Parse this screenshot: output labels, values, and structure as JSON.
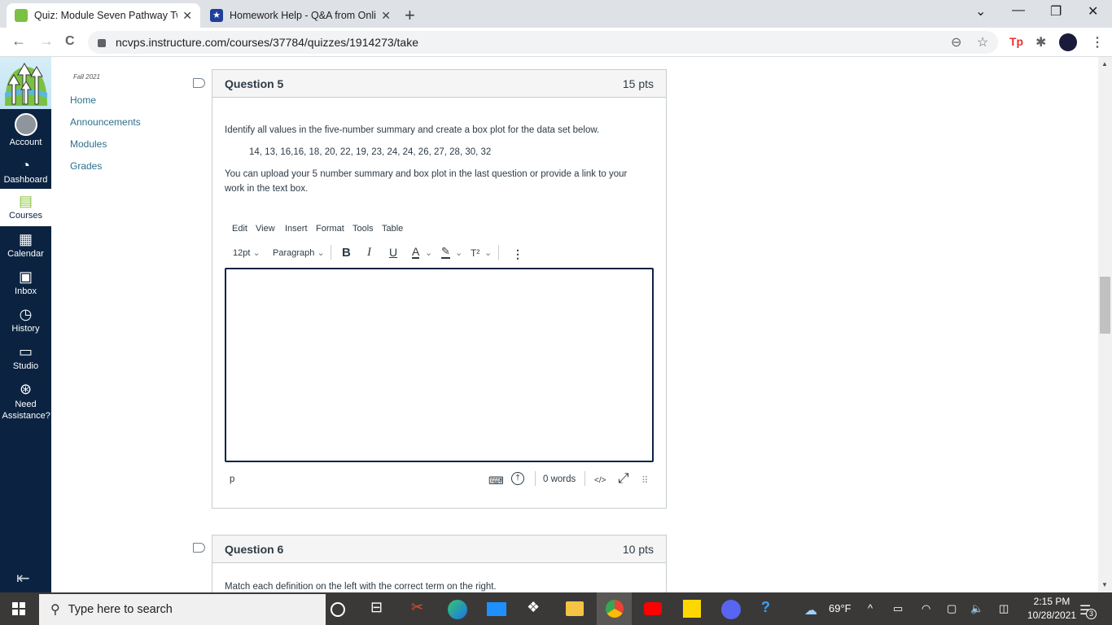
{
  "browser": {
    "tabs": [
      {
        "title": "Quiz: Module Seven Pathway Two",
        "active": true,
        "close": "✕"
      },
      {
        "title": "Homework Help - Q&A from Online",
        "active": false,
        "close": "✕"
      }
    ],
    "new_tab": "+",
    "window_controls": {
      "tab_search": "⌄",
      "minimize": "—",
      "restore": "❐",
      "close": "✕"
    },
    "nav": {
      "back": "←",
      "forward": "→",
      "reload": "C"
    },
    "url": "ncvps.instructure.com/courses/37784/quizzes/1914273/take",
    "toolbar_icons": {
      "zoom": "⊖",
      "bookmark": "☆",
      "extension_tp": "Tp",
      "extensions": "✱",
      "menu": "⋮"
    }
  },
  "global_nav": {
    "items": [
      {
        "label": "Account",
        "icon": "👤"
      },
      {
        "label": "Dashboard",
        "icon": "◔"
      },
      {
        "label": "Courses",
        "icon": "▤"
      },
      {
        "label": "Calendar",
        "icon": "▦"
      },
      {
        "label": "Inbox",
        "icon": "▣"
      },
      {
        "label": "History",
        "icon": "◷"
      },
      {
        "label": "Studio",
        "icon": "▭"
      },
      {
        "label": "Need Assistance?",
        "icon": "⊛"
      }
    ],
    "collapse": "⇤"
  },
  "course_nav": {
    "term": "Fall 2021",
    "items": [
      "Home",
      "Announcements",
      "Modules",
      "Grades"
    ]
  },
  "questions": [
    {
      "title": "Question 5",
      "points": "15 pts",
      "prompt": "Identify all values in the five-number summary and create a box plot for the data set below.",
      "data_set": "14, 13, 16,16, 18, 20, 22, 19, 23, 24, 24, 26, 27, 28, 30, 32",
      "instructions": "You can upload your 5 number summary and box plot in the last question or provide a link to your work in the text box.",
      "editor": {
        "menus": [
          "Edit",
          "View",
          "Insert",
          "Format",
          "Tools",
          "Table"
        ],
        "font_size": "12pt",
        "block_format": "Paragraph",
        "bold": "B",
        "italic": "I",
        "underline": "U",
        "text_color": "A",
        "highlight": "✎",
        "superscript": "T²",
        "more": "⋮",
        "content": "",
        "path": "p",
        "word_count": "0 words",
        "html_toggle": "</>",
        "fullscreen": "⤢",
        "resize": "⠿"
      }
    },
    {
      "title": "Question 6",
      "points": "10 pts",
      "prompt": "Match each definition on the left with the correct term on the right."
    }
  ],
  "taskbar": {
    "search_placeholder": "Type here to search",
    "weather": "69°F",
    "time": "2:15 PM",
    "date": "10/28/2021",
    "notifications": "3"
  }
}
